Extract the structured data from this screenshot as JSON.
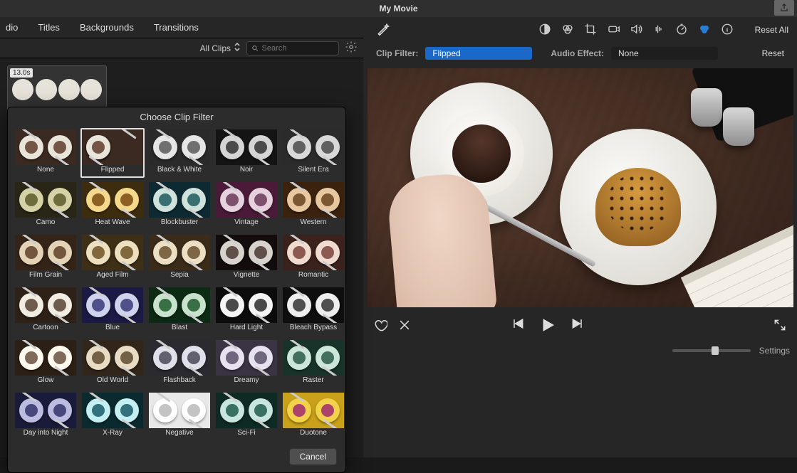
{
  "title": "My Movie",
  "tabs": [
    "dio",
    "Titles",
    "Backgrounds",
    "Transitions"
  ],
  "media_browser": {
    "scope": "All Clips",
    "search_placeholder": "Search"
  },
  "clip": {
    "duration": "13.0s"
  },
  "filter_panel": {
    "title": "Choose Clip Filter",
    "cancel": "Cancel",
    "selected": "Flipped",
    "filters": [
      {
        "name": "None",
        "bg": "#3a2a22",
        "plate": "#eae5db",
        "ink": "#5e3d2a"
      },
      {
        "name": "Flipped",
        "bg": "#3a2a22",
        "plate": "#eae5db",
        "ink": "#5e3d2a"
      },
      {
        "name": "Black & White",
        "bg": "#2a2a2a",
        "plate": "#e6e6e6",
        "ink": "#5a5a5a"
      },
      {
        "name": "Noir",
        "bg": "#141414",
        "plate": "#d5d5d5",
        "ink": "#333333"
      },
      {
        "name": "Silent Era",
        "bg": "#2b2b2b",
        "plate": "#d9d9d9",
        "ink": "#4a4a4a"
      },
      {
        "name": "Camo",
        "bg": "#2a2617",
        "plate": "#d6d2a8",
        "ink": "#5a5a2a"
      },
      {
        "name": "Heat Wave",
        "bg": "#3e2c0e",
        "plate": "#f4d98c",
        "ink": "#7a4a12"
      },
      {
        "name": "Blockbuster",
        "bg": "#0d2a33",
        "plate": "#cfe2dc",
        "ink": "#1e5a5e"
      },
      {
        "name": "Vintage",
        "bg": "#4a1a38",
        "plate": "#e6d2df",
        "ink": "#6a3a5a"
      },
      {
        "name": "Western",
        "bg": "#3a220f",
        "plate": "#e7c8a0",
        "ink": "#6a4321"
      },
      {
        "name": "Film Grain",
        "bg": "#342418",
        "plate": "#e5d3b8",
        "ink": "#5e4128"
      },
      {
        "name": "Aged Film",
        "bg": "#3e2f17",
        "plate": "#ece0bf",
        "ink": "#6e5326"
      },
      {
        "name": "Sepia",
        "bg": "#3b2c1a",
        "plate": "#ecdfc4",
        "ink": "#6a5230"
      },
      {
        "name": "Vignette",
        "bg": "#120c0c",
        "plate": "#d8d2cd",
        "ink": "#4a3a34"
      },
      {
        "name": "Romantic",
        "bg": "#3c221c",
        "plate": "#f0dbd0",
        "ink": "#7a433a"
      },
      {
        "name": "Cartoon",
        "bg": "#2e2218",
        "plate": "#f2ede2",
        "ink": "#574334"
      },
      {
        "name": "Blue",
        "bg": "#1a1a44",
        "plate": "#cfd3ec",
        "ink": "#3a3a7a"
      },
      {
        "name": "Blast",
        "bg": "#0d2a14",
        "plate": "#c8e2ce",
        "ink": "#1e5a2c"
      },
      {
        "name": "Hard Light",
        "bg": "#0c0c0c",
        "plate": "#f4f4f4",
        "ink": "#2a2a2a"
      },
      {
        "name": "Bleach Bypass",
        "bg": "#0e0e0e",
        "plate": "#eeeeee",
        "ink": "#333333"
      },
      {
        "name": "Glow",
        "bg": "#2c2016",
        "plate": "#fffaf0",
        "ink": "#6a5040"
      },
      {
        "name": "Old World",
        "bg": "#32261a",
        "plate": "#e8dcc4",
        "ink": "#5e4a30"
      },
      {
        "name": "Flashback",
        "bg": "#2a2a30",
        "plate": "#e0e0ea",
        "ink": "#4a4a5a"
      },
      {
        "name": "Dreamy",
        "bg": "#3a3444",
        "plate": "#e8e2f0",
        "ink": "#5a506a"
      },
      {
        "name": "Raster",
        "bg": "#18342a",
        "plate": "#cce6dc",
        "ink": "#2a5a48"
      },
      {
        "name": "Day into Night",
        "bg": "#1a1a3a",
        "plate": "#bcbce0",
        "ink": "#34346a"
      },
      {
        "name": "X-Ray",
        "bg": "#0a2a30",
        "plate": "#c4f0f4",
        "ink": "#1a5a66"
      },
      {
        "name": "Negative",
        "bg": "#e8e8e8",
        "plate": "#ffffff",
        "ink": "#bababa"
      },
      {
        "name": "Sci-Fi",
        "bg": "#0e2a24",
        "plate": "#c8e6de",
        "ink": "#1e5a4c"
      },
      {
        "name": "Duotone",
        "bg": "#c9a11a",
        "plate": "#f2d24a",
        "ink": "#a02a70"
      }
    ]
  },
  "inspector": {
    "clip_filter_label": "Clip Filter:",
    "clip_filter_value": "Flipped",
    "audio_effect_label": "Audio Effect:",
    "audio_effect_value": "None",
    "reset_all": "Reset All",
    "reset": "Reset"
  },
  "settings_label": "Settings"
}
